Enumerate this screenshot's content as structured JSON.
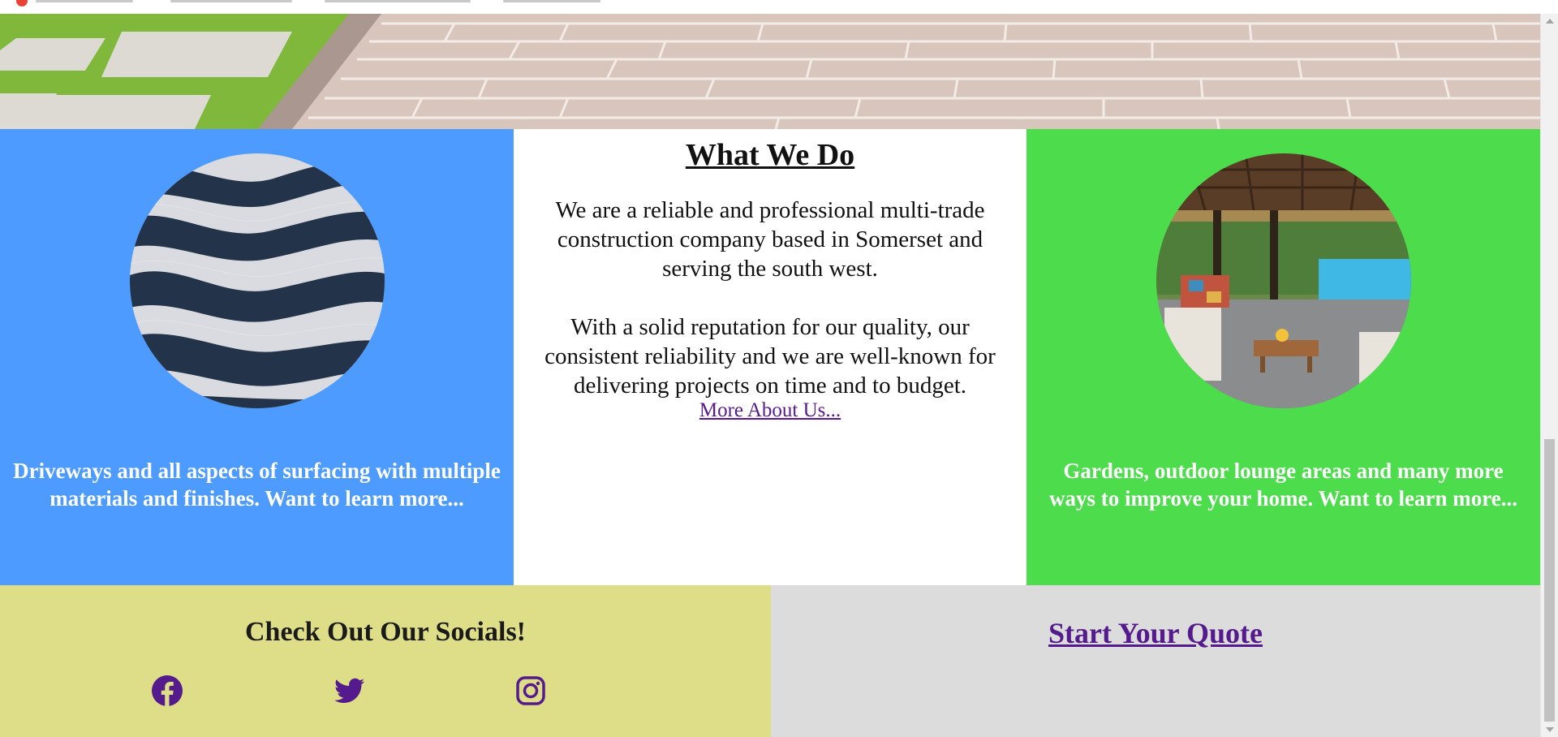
{
  "colors": {
    "driveways_bg": "#4d9bff",
    "gardens_bg": "#4cdc4c",
    "socials_bg": "#dede88",
    "quote_bg": "#dcdcdc",
    "link": "#551a8b"
  },
  "hero": {
    "image": "paving-and-grass-photo"
  },
  "features": {
    "driveways": {
      "image": "mosaic-pavement-photo",
      "caption": "Driveways and all aspects of surfacing with multiple materials and finishes. Want to learn more..."
    },
    "about": {
      "title": "What We Do",
      "paragraph1": "We are a reliable and professional multi-trade construction company based in Somerset and serving the south west.",
      "paragraph2": "With a solid reputation for our quality, our consistent reliability and we are well-known for delivering projects on time and to budget.",
      "link_text": "More About Us..."
    },
    "gardens": {
      "image": "outdoor-lounge-photo",
      "caption": "Gardens, outdoor lounge areas and many more ways to improve your home. Want to learn more..."
    }
  },
  "socials": {
    "title": "Check Out Our Socials!",
    "icons": [
      "facebook-icon",
      "twitter-icon",
      "instagram-icon"
    ]
  },
  "quote": {
    "link_text": "Start Your Quote"
  }
}
